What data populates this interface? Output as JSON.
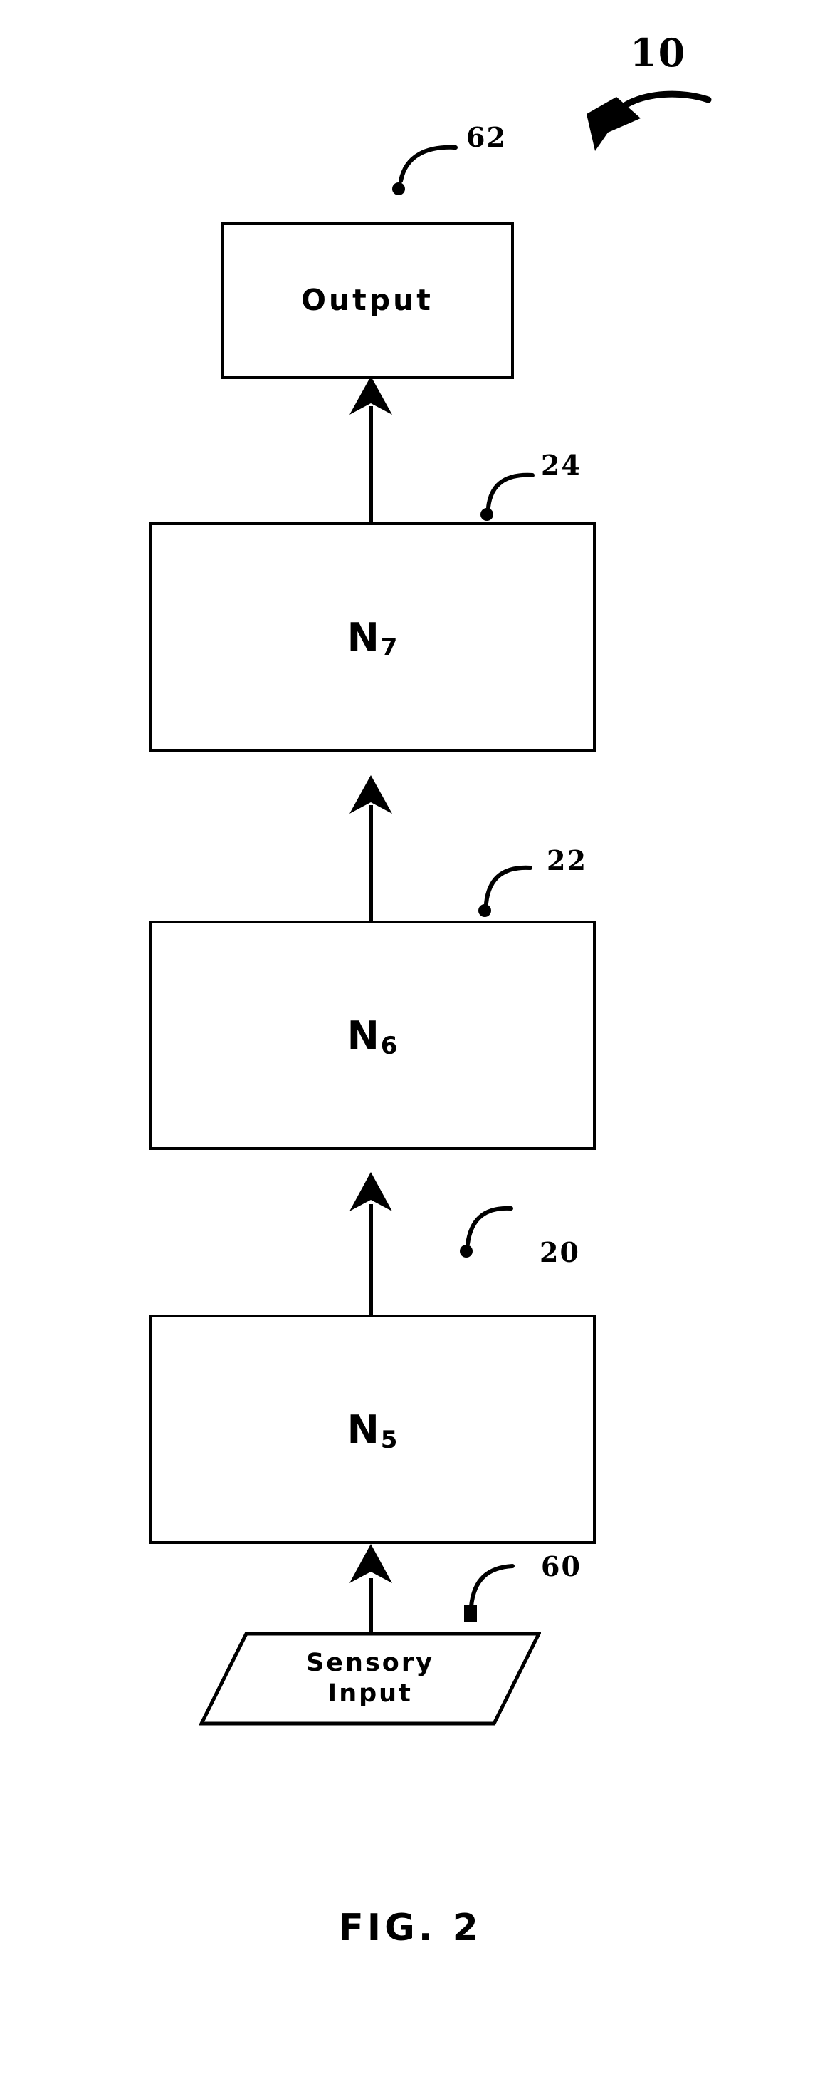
{
  "figure": {
    "caption": "FIG. 2",
    "main_reference": "10"
  },
  "nodes": {
    "output": {
      "label": "Output",
      "ref": "62"
    },
    "n7": {
      "letter": "N",
      "subscript": "7",
      "ref": "24"
    },
    "n6": {
      "letter": "N",
      "subscript": "6",
      "ref": "22"
    },
    "n5": {
      "letter": "N",
      "subscript": "5",
      "ref": "20"
    },
    "sensory_input": {
      "line1": "Sensory",
      "line2": "Input",
      "ref": "60"
    }
  },
  "connectors": [
    {
      "from": "sensory_input",
      "to": "n5",
      "direction": "up"
    },
    {
      "from": "n5",
      "to": "n6",
      "direction": "up"
    },
    {
      "from": "n6",
      "to": "n7",
      "direction": "up"
    },
    {
      "from": "n7",
      "to": "output",
      "direction": "up"
    }
  ],
  "colors": {
    "stroke": "#000000",
    "background": "#ffffff"
  }
}
